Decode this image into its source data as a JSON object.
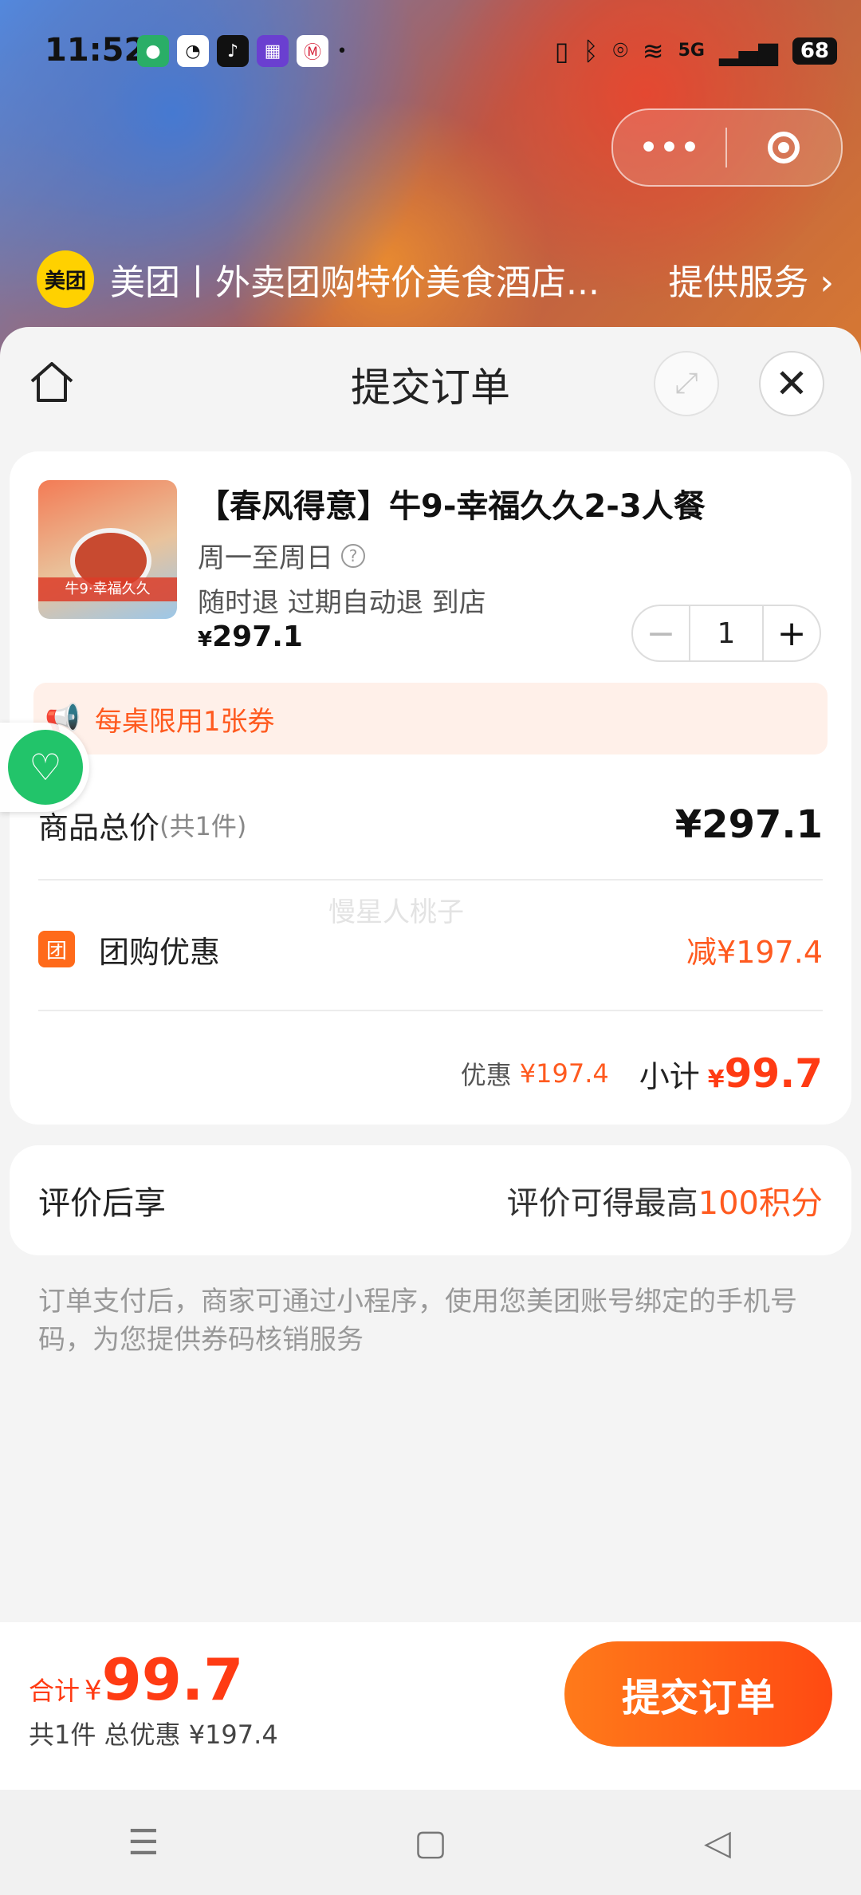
{
  "status_bar": {
    "time": "11:52",
    "network": "5G",
    "battery": "68"
  },
  "capsule": {
    "menu_icon": "more-dots-icon",
    "close_icon": "target-icon"
  },
  "provider": {
    "logo_text": "美团",
    "name": "美团丨外卖团购特价美食酒店...",
    "service_label": "提供服务 ›"
  },
  "sheet": {
    "title": "提交订单"
  },
  "deal": {
    "title": "【春风得意】牛9-幸福久久2-3人餐",
    "days": "周一至周日",
    "policy": "随时退 过期自动退 到店",
    "price_symbol": "¥",
    "price": "297.1",
    "quantity": "1",
    "image_caption": "牛9·幸福久久"
  },
  "limit_notice": "每桌限用1张券",
  "summary": {
    "total_label": "商品总价",
    "total_count": "(共1件)",
    "total_amount": "¥297.1",
    "watermark": "慢星人桃子",
    "groupbuy_badge": "团",
    "groupbuy_label": "团购优惠",
    "groupbuy_discount": "减¥197.4",
    "discount_label": "优惠",
    "discount_value": "¥197.4",
    "subtotal_label": "小计",
    "subtotal_symbol": "¥",
    "subtotal_value": "99.7"
  },
  "review": {
    "label": "评价后享",
    "right_text": "评价可得最高",
    "right_points": "100积分"
  },
  "notice": "订单支付后，商家可通过小程序，使用您美团账号绑定的手机号码，为您提供券码核销服务",
  "bottom": {
    "total_label": "合计",
    "total_symbol": "¥",
    "total_amount": "99.7",
    "sub_text": "共1件 总优惠 ¥197.4",
    "submit_label": "提交订单"
  },
  "colors": {
    "accent": "#ff5a1f",
    "price_red": "#ff3b13",
    "limit_bg": "#fff0e9",
    "float_green": "#22c46a"
  }
}
